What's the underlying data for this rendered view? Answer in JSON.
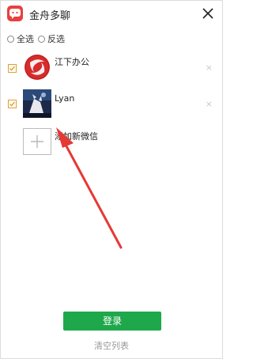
{
  "app": {
    "title": "金舟多聊"
  },
  "select": {
    "all_label": "全选",
    "invert_label": "反选"
  },
  "accounts": [
    {
      "name": "江下办公",
      "checked": true,
      "remove_glyph": "×"
    },
    {
      "name": "Lyan",
      "checked": true,
      "remove_glyph": "×"
    }
  ],
  "add_new": {
    "label": "添加新微信",
    "icon": "plus-icon"
  },
  "footer": {
    "login_label": "登录",
    "clear_label": "清空列表"
  },
  "colors": {
    "brand_red": "#e8403e",
    "login_green": "#1fa84b",
    "checkbox_orange": "#e0a030",
    "arrow_red": "#e53935"
  }
}
